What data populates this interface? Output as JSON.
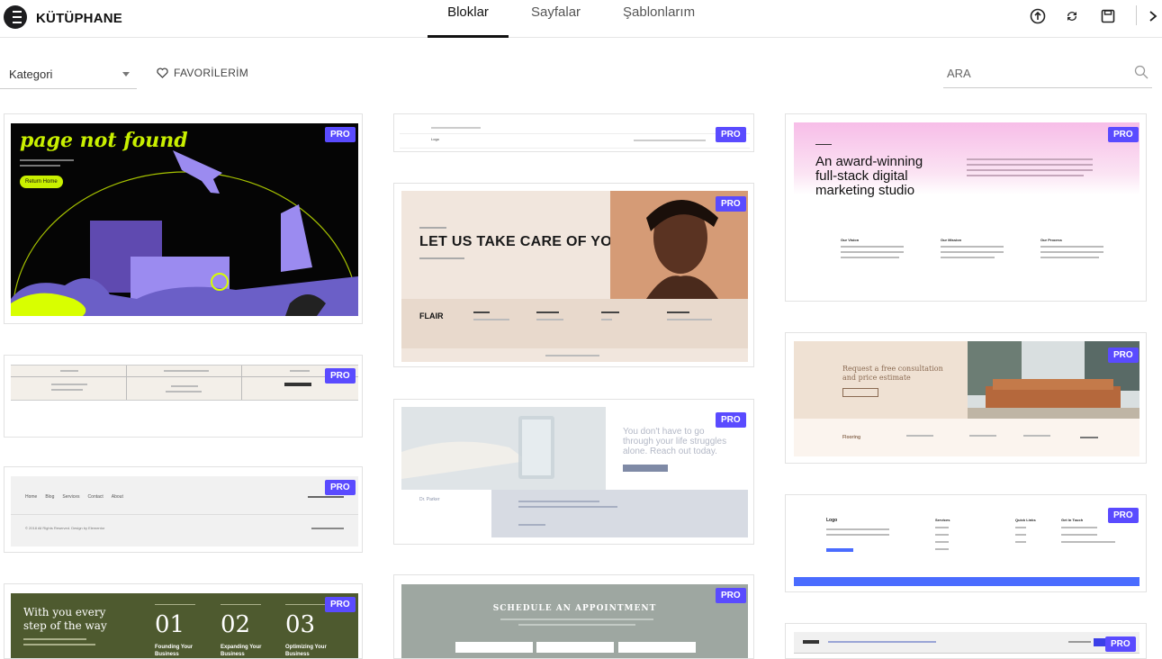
{
  "header": {
    "brand": "KÜTÜPHANE",
    "tabs": [
      {
        "label": "Bloklar",
        "active": true
      },
      {
        "label": "Sayfalar",
        "active": false
      },
      {
        "label": "Şablonlarım",
        "active": false
      }
    ],
    "tools": [
      "upload-icon",
      "sync-icon",
      "save-icon",
      "close-icon"
    ]
  },
  "filters": {
    "category_label": "Kategori",
    "favorites_label": "FAVORİLERİM",
    "search_placeholder": "ARA"
  },
  "badge": "PRO",
  "colors": {
    "accent": "#5a4bff",
    "active_tab": "#111111"
  },
  "cards": {
    "c404": {
      "title": "page not found",
      "button": "Return Home"
    },
    "beauty": {
      "title": "LET US TAKE CARE OF YOU",
      "logo": "FLAIR"
    },
    "agency": {
      "title_line1": "An award-winning",
      "title_line2": "full-stack digital",
      "title_line3": "marketing studio",
      "col1": "Our Vision",
      "col2": "Our Mission",
      "col3": "Our Process"
    },
    "consult": {
      "title_line1": "Request a free consultation",
      "title_line2": "and price estimate",
      "brand": "Flooring"
    },
    "therapy": {
      "title_line1": "You don't have to go",
      "title_line2": "through your life struggles",
      "title_line3": "alone. Reach out today.",
      "name": "Dr. Parker"
    },
    "footer_links": {
      "links": [
        "Home",
        "Blog",
        "Services",
        "Contact",
        "About"
      ],
      "copyright": "© 2018 All Rights Reserved. Design by Elementor"
    },
    "footer_cols": {
      "logo": "Logo",
      "col1": "Services",
      "col2": "Quick Links",
      "col3": "Get In Touch"
    },
    "steps": {
      "title_line1": "With you every",
      "title_line2": "step of the way",
      "n1": "01",
      "n2": "02",
      "n3": "03",
      "l1_line1": "Founding Your",
      "l1_line2": "Business",
      "l2_line1": "Expanding Your",
      "l2_line2": "Business",
      "l3_line1": "Optimizing Your",
      "l3_line2": "Business"
    },
    "appointment": {
      "title": "SCHEDULE AN APPOINTMENT"
    },
    "header_block": {
      "logo": "Logo"
    }
  }
}
